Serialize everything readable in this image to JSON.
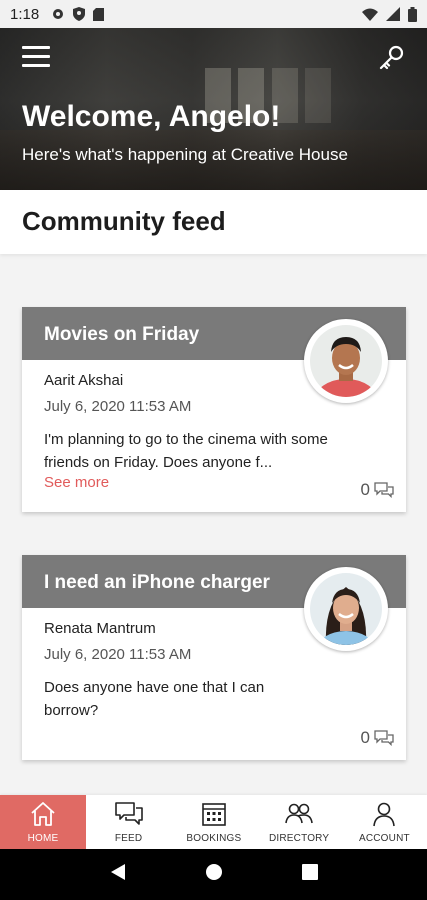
{
  "status_bar": {
    "time": "1:18",
    "icons": [
      "gear-icon",
      "shield-icon",
      "sd-card-icon"
    ],
    "right_icons": [
      "wifi-icon",
      "signal-icon",
      "battery-icon"
    ]
  },
  "hero": {
    "title": "Welcome, Angelo!",
    "subtitle": "Here's what's happening at Creative House",
    "icons": [
      "menu-icon",
      "key-icon"
    ]
  },
  "section": {
    "title": "Community feed"
  },
  "posts": [
    {
      "title": "Movies on Friday",
      "author": "Aarit Akshai",
      "date": "July 6, 2020 11:53 AM",
      "text": "I'm planning to go to the cinema with some friends on Friday. Does anyone f...",
      "see_more": "See more",
      "comments": "0"
    },
    {
      "title": "I need an iPhone charger",
      "author": "Renata Mantrum",
      "date": "July 6, 2020 11:53 AM",
      "text": "Does anyone have one that I can borrow?",
      "comments": "0"
    }
  ],
  "bottom_nav": [
    {
      "label": "HOME",
      "icon": "home-icon",
      "active": true
    },
    {
      "label": "FEED",
      "icon": "chat-icon"
    },
    {
      "label": "BOOKINGS",
      "icon": "calendar-icon"
    },
    {
      "label": "DIRECTORY",
      "icon": "people-icon"
    },
    {
      "label": "ACCOUNT",
      "icon": "person-icon"
    }
  ],
  "colors": {
    "accent": "#e06a64",
    "link": "#e15b5b",
    "card_header": "#7a7a7a"
  }
}
